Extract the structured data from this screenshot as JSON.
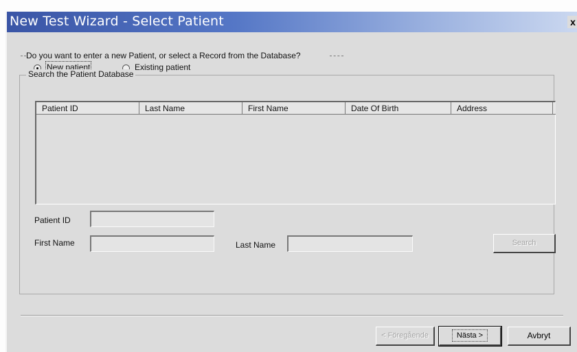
{
  "window": {
    "title": "New Test Wizard - Select Patient",
    "close_glyph": "x"
  },
  "choice": {
    "question": "Do you want to enter a new Patient, or select a Record from the Database?",
    "new_patient_label": "New patient",
    "existing_patient_label": "Existing patient",
    "selected": "new_patient"
  },
  "search": {
    "group_title": "Search the Patient Database",
    "columns": [
      "Patient ID",
      "Last Name",
      "First Name",
      "Date Of Birth",
      "Address"
    ],
    "rows": [],
    "patient_id_label": "Patient ID",
    "first_name_label": "First Name",
    "last_name_label": "Last Name",
    "patient_id_value": "",
    "first_name_value": "",
    "last_name_value": "",
    "search_button": "Search"
  },
  "footer": {
    "back_button": "< Föregående",
    "next_button": "Nästa >",
    "cancel_button": "Avbryt"
  }
}
